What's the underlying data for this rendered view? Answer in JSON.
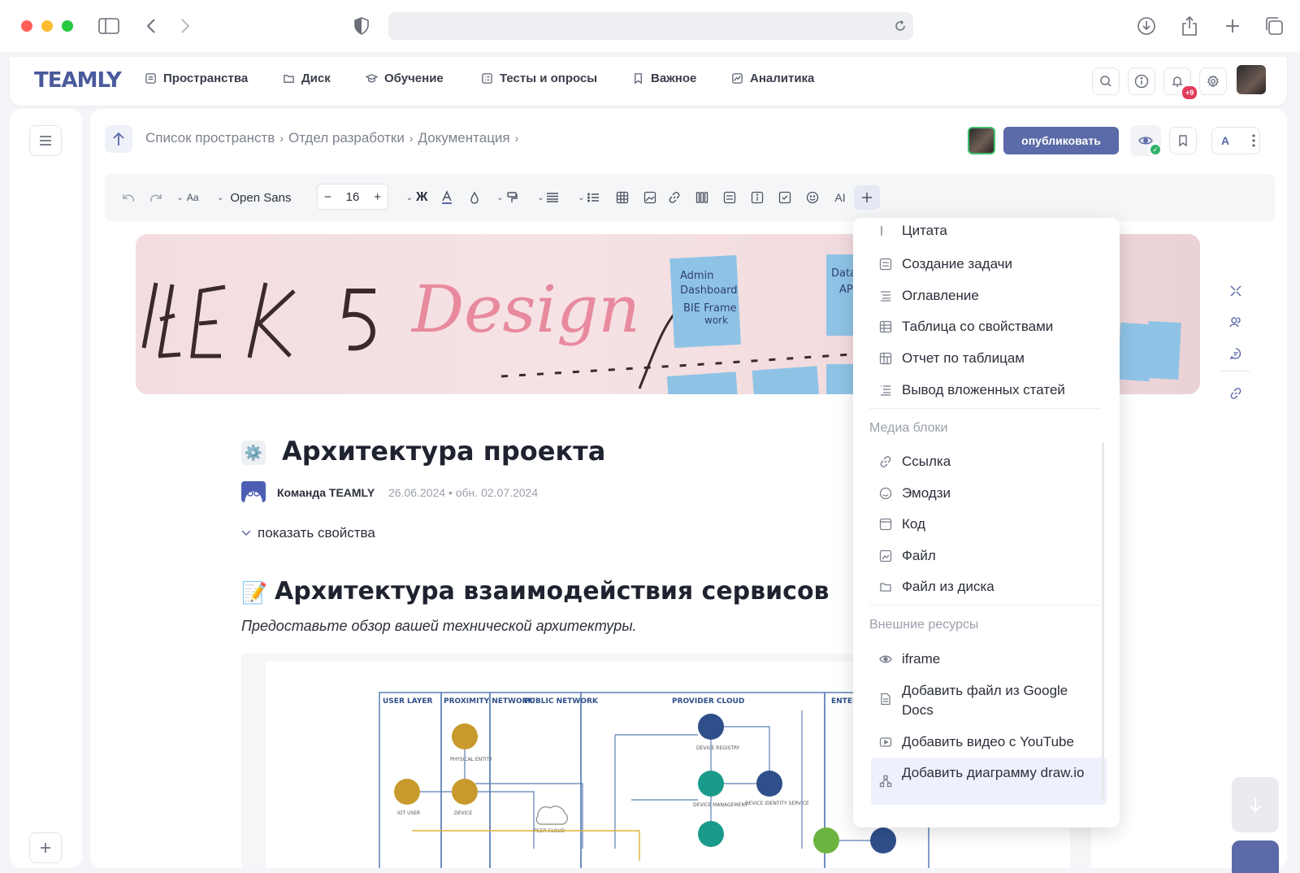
{
  "browser": {
    "url": ""
  },
  "app": {
    "logo": "TEAMLY",
    "nav": [
      {
        "label": "Пространства",
        "icon": "spaces-icon"
      },
      {
        "label": "Диск",
        "icon": "folder-icon"
      },
      {
        "label": "Обучение",
        "icon": "learning-icon"
      },
      {
        "label": "Тесты и опросы",
        "icon": "tests-icon"
      },
      {
        "label": "Важное",
        "icon": "bookmark-icon"
      },
      {
        "label": "Аналитика",
        "icon": "analytics-icon"
      }
    ],
    "notification_badge": "+9"
  },
  "breadcrumbs": [
    "Список пространств",
    "Отдел разработки",
    "Документация"
  ],
  "actions": {
    "publish_label": "опубликовать",
    "font_button": "A"
  },
  "toolbar": {
    "font_family": "Open Sans",
    "font_size": "16",
    "bold": "Ж",
    "text_size_icon": "Aa",
    "ai_label": "AI"
  },
  "cover": {
    "text_main": "EEK 5",
    "text_design": "Design",
    "sticky_1": "Admin Dashboard BIE Frame work",
    "sticky_2": "Datab API"
  },
  "document": {
    "title_emoji": "⚙️",
    "title": "Архитектура проекта",
    "author": "Команда TEAMLY",
    "dates": "26.06.2024 • обн. 02.07.2024",
    "show_props": "показать свойства",
    "section_emoji": "📝",
    "section_title": "Архитектура взаимодействия сервисов",
    "section_subtitle": "Предоставьте обзор вашей технической архитектуры."
  },
  "diagram": {
    "columns": [
      "USER LAYER",
      "PROXIMITY NETWORK",
      "PUBLIC NETWORK",
      "PROVIDER CLOUD",
      "ENTERI"
    ],
    "nodes": [
      "PHYSICAL ENTITY",
      "DEVICE",
      "IOT USER",
      "PEER CLOUD",
      "DEVICE REGISTRY",
      "DEVICE MANAGEMENT",
      "DEVICE IDENTITY SERVICE"
    ]
  },
  "menu": {
    "partial_top": "Цитата",
    "items_a": [
      {
        "label": "Создание задачи",
        "icon": "task-icon"
      },
      {
        "label": "Оглавление",
        "icon": "toc-icon"
      },
      {
        "label": "Таблица со свойствами",
        "icon": "table-props-icon"
      },
      {
        "label": "Отчет по таблицам",
        "icon": "table-report-icon"
      },
      {
        "label": "Вывод вложенных статей",
        "icon": "nested-articles-icon"
      }
    ],
    "media_header": "Медиа блоки",
    "items_media": [
      {
        "label": "Ссылка",
        "icon": "link-icon"
      },
      {
        "label": "Эмодзи",
        "icon": "emoji-icon"
      },
      {
        "label": "Код",
        "icon": "code-icon"
      },
      {
        "label": "Файл",
        "icon": "file-icon"
      },
      {
        "label": "Файл из диска",
        "icon": "disk-file-icon"
      }
    ],
    "external_header": "Внешние ресурсы",
    "items_external": [
      {
        "label": "iframe",
        "icon": "iframe-icon"
      },
      {
        "label": "Добавить файл из Google Docs",
        "icon": "google-docs-icon"
      },
      {
        "label": "Добавить видео с YouTube",
        "icon": "youtube-icon"
      },
      {
        "label": "Добавить диаграмму draw.io",
        "icon": "drawio-icon"
      }
    ]
  },
  "colors": {
    "accent": "#5b6aa8",
    "publish": "#5b6aa8",
    "highlight": "#eef0fb",
    "badge": "#e23b5b"
  }
}
